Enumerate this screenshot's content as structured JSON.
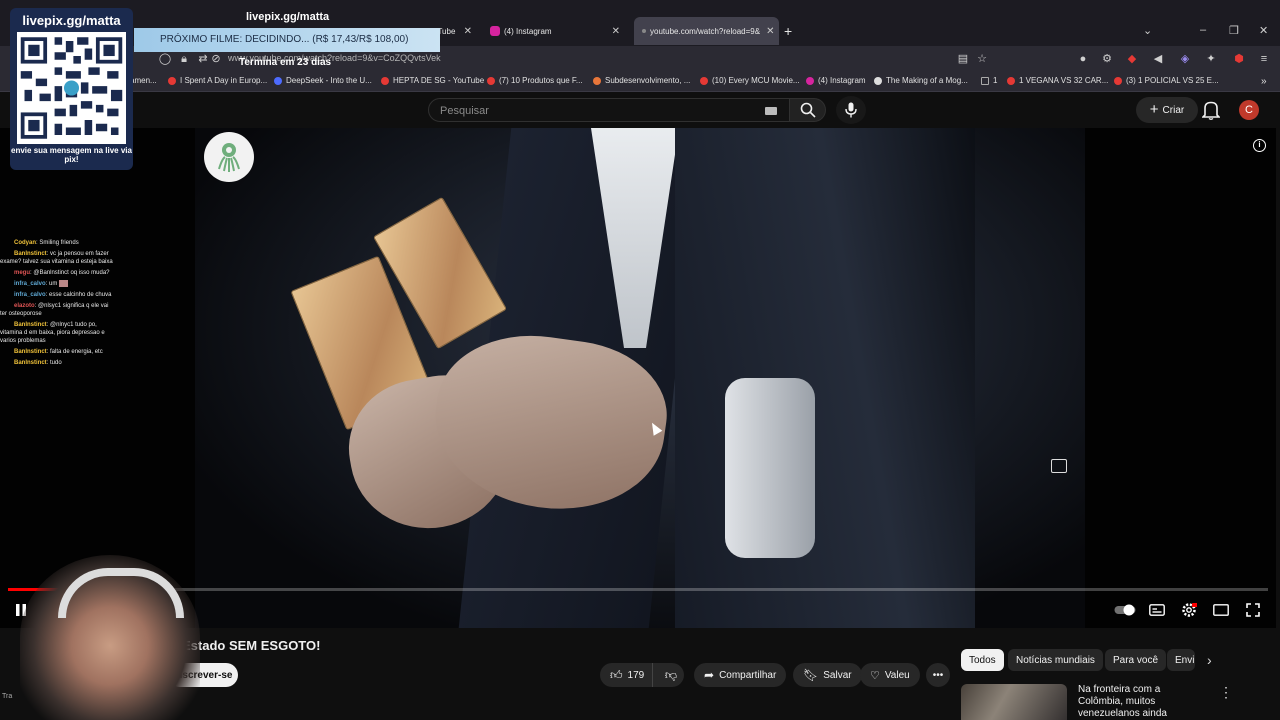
{
  "stream": {
    "qr_title": "livepix.gg/matta",
    "qr_caption": "envie sua mensagem na live via pix!",
    "overlay_title": "livepix.gg/matta",
    "next_movie": "PRÓXIMO FILME: DECIDINDO... (R$ 17,43/R$ 108,00)",
    "ends_in": "Termina em 23 dias",
    "tray_text": "Tra"
  },
  "browser": {
    "tabs": [
      {
        "label": "uTube",
        "active": false
      },
      {
        "label": "(4) Instagram",
        "active": false
      },
      {
        "label": "youtube.com/watch?reload=9&",
        "active": true
      }
    ],
    "new_tab": "+",
    "url": "www.youtube.com/watch?reload=9&v=CoZQQvtsVek",
    "bookmarks": [
      {
        "label": "amen...",
        "color": "#e53935"
      },
      {
        "label": "I Spent A Day in Europ...",
        "color": "#e53935"
      },
      {
        "label": "DeepSeek - Into the U...",
        "color": "#4d6bfe"
      },
      {
        "label": "HEPTA DE SG - YouTube",
        "color": "#e53935"
      },
      {
        "label": "(7) 10 Produtos que F...",
        "color": "#e53935"
      },
      {
        "label": "Subdesenvolvimento, ...",
        "color": "#e8763a"
      },
      {
        "label": "(10) Every MCU Movie...",
        "color": "#e53935"
      },
      {
        "label": "(4) Instagram",
        "color": "#d6249f"
      },
      {
        "label": "The Making of a Mog...",
        "color": "#dddddd"
      },
      {
        "label": "1",
        "color": "#aaaaaa"
      },
      {
        "label": "1 VEGANA VS 32 CAR...",
        "color": "#e53935"
      },
      {
        "label": "(3) 1 POLICIAL VS 25 E...",
        "color": "#e53935"
      }
    ]
  },
  "youtube": {
    "search_placeholder": "Pesquisar",
    "create_label": "Criar",
    "avatar_letter": "C",
    "video_title": "Estado SEM ESGOTO!",
    "subscribe_label": "Inscrever-se",
    "likes": "179",
    "share_label": "Compartilhar",
    "save_label": "Salvar",
    "thanks_label": "Valeu",
    "progress": 0.05,
    "chips": [
      "Todos",
      "Notícias mundiais",
      "Para você",
      "Envi"
    ],
    "recommended_title": "Na fronteira com a Colômbia, muitos venezuelanos ainda"
  },
  "chat": [
    {
      "user": "Codyan",
      "color": "#f0c23a",
      "text": "Smiling friends"
    },
    {
      "user": "Banlnstinct",
      "color": "#f0c23a",
      "text": "vc ja pensou em fazer exame? talvez sua vitamina d esteja baixa"
    },
    {
      "user": "megu",
      "color": "#e05555",
      "text": "@Banlnstinct oq isso muda?"
    },
    {
      "user": "infra_calvo",
      "color": "#5fa8d3",
      "text": "um"
    },
    {
      "user": "infra_calvo",
      "color": "#5fa8d3",
      "text": "esse calcinho de chuva"
    },
    {
      "user": "elazoto",
      "color": "#e05555",
      "text": "@nlsyc1 significa q ele vai ter osteoporose"
    },
    {
      "user": "Banlnstinct",
      "color": "#f0c23a",
      "text": "@nlnyc1 tudo po, vitamina d em baixa, piora depressao e varios problemas"
    },
    {
      "user": "Banlnstinct",
      "color": "#f0c23a",
      "text": "falta de energia, etc"
    },
    {
      "user": "Banlnstinct",
      "color": "#f0c23a",
      "text": "tudo"
    }
  ]
}
